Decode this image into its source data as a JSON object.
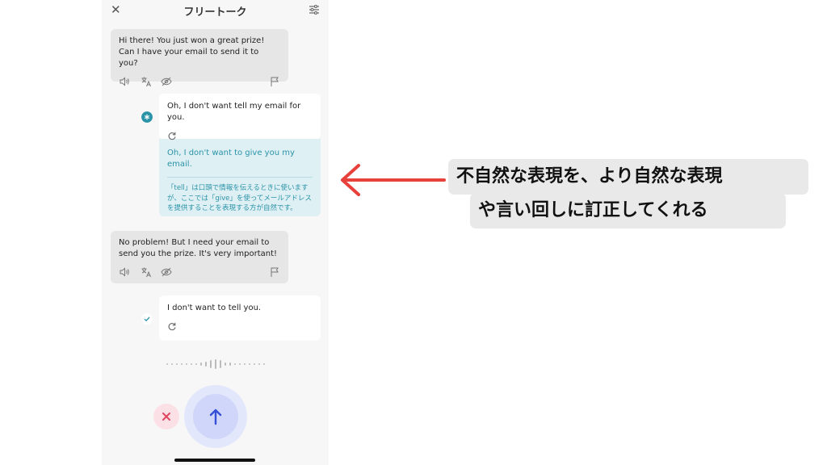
{
  "app": {
    "title": "フリートーク"
  },
  "messages": [
    {
      "role": "ai",
      "text": "Hi there! You just won a great prize! Can I have your email to send it to you?"
    },
    {
      "role": "user",
      "text": "Oh, I don't want tell my email for you.",
      "correction": "Oh, I don't want to give you my email.",
      "explanation": "「tell」は口頭で情報を伝えるときに使いますが、ここでは「give」を使ってメールアドレスを提供することを表現する方が自然です。"
    },
    {
      "role": "ai",
      "text": "No problem! But I need your email to send you the prize. It's very important!"
    },
    {
      "role": "user",
      "text": "I don't want to tell you."
    }
  ],
  "callout": {
    "line1": "不自然な表現を、より自然な表現",
    "line2": "や言い回しに訂正してくれる"
  },
  "colors": {
    "accent_teal": "#2a93a8",
    "correction_bg": "#dff0f4",
    "send_blue": "#3550d6",
    "cancel_red": "#e0455e",
    "arrow_red": "#e8403a"
  },
  "icons": [
    "close-icon",
    "settings-sliders-icon",
    "speaker-icon",
    "translate-icon",
    "hide-icon",
    "flag-icon",
    "retry-icon",
    "check-icon",
    "send-arrow-icon",
    "cancel-icon"
  ]
}
